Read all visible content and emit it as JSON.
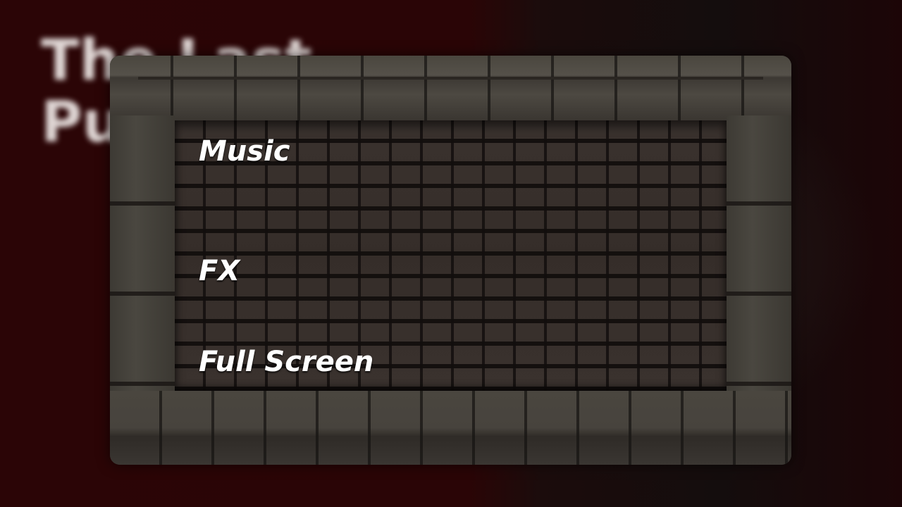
{
  "background": {
    "title": "The Last\nPu",
    "colors": {
      "backdrop": "#2b0506",
      "panel_stone": "#4a463f",
      "brick": "#352d29"
    }
  },
  "settings_menu": {
    "options": [
      {
        "label": "Music"
      },
      {
        "label": "FX"
      },
      {
        "label": "Full Screen"
      }
    ]
  }
}
